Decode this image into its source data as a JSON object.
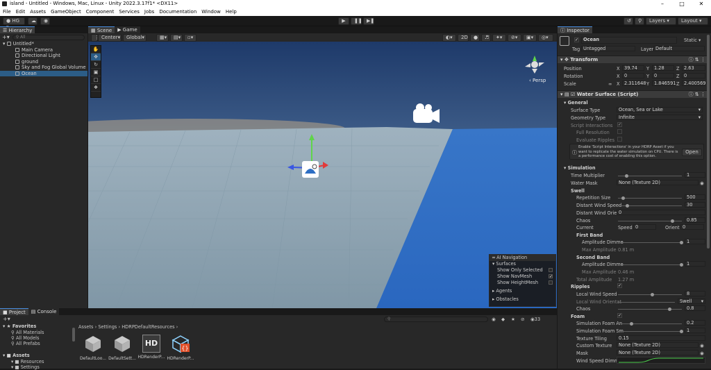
{
  "title": "island - Untitled - Windows, Mac, Linux - Unity 2022.3.17f1* <DX11>",
  "menu": [
    "File",
    "Edit",
    "Assets",
    "GameObject",
    "Component",
    "Services",
    "Jobs",
    "Documentation",
    "Window",
    "Help"
  ],
  "toolbar": {
    "account": "HG",
    "layers": "Layers",
    "layout": "Layout"
  },
  "hierarchy": {
    "tab": "Hierarchy",
    "search_placeholder": "All",
    "scene": "Untitled*",
    "items": [
      "Main Camera",
      "Directional Light",
      "ground",
      "Sky and Fog Global Volume",
      "Ocean"
    ]
  },
  "scene": {
    "tabs": [
      "Scene",
      "Game"
    ],
    "pivot": "Center",
    "space": "Global",
    "mode2d": "2D",
    "persp": "Persp"
  },
  "ai_nav": {
    "title": "AI Navigation",
    "surfaces": "Surfaces",
    "opts": [
      {
        "label": "Show Only Selected",
        "checked": false
      },
      {
        "label": "Show NavMesh",
        "checked": true
      },
      {
        "label": "Show HeightMesh",
        "checked": false
      }
    ],
    "agents": "Agents",
    "obstacles": "Obstacles"
  },
  "inspector": {
    "tab": "Inspector",
    "name": "Ocean",
    "static": "Static",
    "tag_label": "Tag",
    "tag": "Untagged",
    "layer_label": "Layer",
    "layer": "Default",
    "transform": {
      "title": "Transform",
      "rows": [
        {
          "label": "Position",
          "x": "39.74",
          "y": "1.28",
          "z": "2.63"
        },
        {
          "label": "Rotation",
          "x": "0",
          "y": "0",
          "z": "0"
        },
        {
          "label": "Scale",
          "x": "2.311648",
          "y": "1.846591",
          "z": "2.400569"
        }
      ]
    },
    "water": {
      "title": "Water Surface (Script)",
      "general": "General",
      "surface_type_label": "Surface Type",
      "surface_type": "Ocean, Sea or Lake",
      "geometry_type_label": "Geometry Type",
      "geometry_type": "Infinite",
      "script_interactions": "Script Interactions",
      "full_resolution": "Full Resolution",
      "evaluate_ripples": "Evaluate Ripples",
      "help": "Enable 'Script Interactions' in your HDRP Asset if you want to replicate the water simulation on CPU. There is a performance cost of enabling this option.",
      "open": "Open",
      "simulation": "Simulation",
      "time_multiplier_label": "Time Multiplier",
      "time_multiplier": "1",
      "water_mask_label": "Water Mask",
      "water_mask": "None (Texture 2D)",
      "swell": "Swell",
      "rep_size_label": "Repetition Size",
      "rep_size": "500",
      "dist_wind_speed_label": "Distant Wind Speed",
      "dist_wind_speed": "30",
      "dist_wind_orient_label": "Distant Wind Orient",
      "dist_wind_orient": "0",
      "chaos_label": "Chaos",
      "chaos": "0.85",
      "current_label": "Current",
      "speed_label": "Speed",
      "speed": "0",
      "orient_label": "Orient",
      "orient": "0",
      "first_band": "First Band",
      "amp_label": "Amplitude Dimme",
      "amp1": "1",
      "max_amp_label": "Max Amplitude",
      "max_amp1": "0.81 m",
      "second_band": "Second Band",
      "amp2": "1",
      "max_amp2": "0.46 m",
      "total_amp_label": "Total Amplitude",
      "total_amp": "1.27 m",
      "ripples": "Ripples",
      "local_wind_speed_label": "Local Wind Speed",
      "local_wind_speed": "8",
      "local_wind_orient_label": "Local Wind Orientat",
      "local_wind_orient": "Swell",
      "ripple_chaos": "0.8",
      "foam": "Foam",
      "sim_foam_an_label": "Simulation Foam An",
      "sim_foam_an": "0.2",
      "sim_foam_sm_label": "Simulation Foam Sm",
      "sim_foam_sm": "1",
      "tex_tiling_label": "Texture Tiling",
      "tex_tiling": "0.15",
      "custom_tex_label": "Custom Texture",
      "custom_tex": "None (Texture 2D)",
      "mask_label": "Mask",
      "mask": "None (Texture 2D)",
      "wind_speed_dim_label": "Wind Speed Dimme"
    }
  },
  "project": {
    "tabs": [
      "Project",
      "Console"
    ],
    "breadcrumb": [
      "Assets",
      "Settings",
      "HDRPDefaultResources"
    ],
    "favorites": "Favorites",
    "fav_items": [
      "All Materials",
      "All Models",
      "All Prefabs"
    ],
    "assets": "Assets",
    "asset_items": [
      "Resources",
      "Settings"
    ],
    "count": "33",
    "files": [
      "DefaultLoo...",
      "DefaultSett...",
      "HDRenderP...",
      "HDRenderP..."
    ]
  },
  "colors": {
    "accent": "#2c5d87",
    "water": "#2e6fc4",
    "ground": "#8ea5b3"
  }
}
